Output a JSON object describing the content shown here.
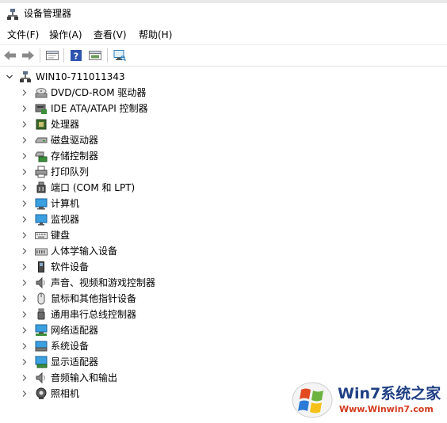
{
  "window": {
    "title": "设备管理器"
  },
  "menu": [
    {
      "label": "文件(F)"
    },
    {
      "label": "操作(A)"
    },
    {
      "label": "查看(V)"
    },
    {
      "label": "帮助(H)"
    }
  ],
  "toolbar": {
    "buttons": [
      {
        "icon": "back-arrow-icon"
      },
      {
        "icon": "forward-arrow-icon"
      },
      {
        "icon": "properties-icon"
      },
      {
        "icon": "help-icon"
      },
      {
        "icon": "update-driver-icon"
      },
      {
        "icon": "scan-hardware-icon"
      }
    ]
  },
  "tree": {
    "root": {
      "label": "WIN10-711011343",
      "icon": "computer-network-icon"
    },
    "items": [
      {
        "label": "DVD/CD-ROM 驱动器",
        "icon": "dvd-drive-icon"
      },
      {
        "label": "IDE ATA/ATAPI 控制器",
        "icon": "ide-controller-icon"
      },
      {
        "label": "处理器",
        "icon": "processor-icon"
      },
      {
        "label": "磁盘驱动器",
        "icon": "disk-drive-icon"
      },
      {
        "label": "存储控制器",
        "icon": "storage-controller-icon"
      },
      {
        "label": "打印队列",
        "icon": "printer-icon"
      },
      {
        "label": "端口 (COM 和 LPT)",
        "icon": "port-icon"
      },
      {
        "label": "计算机",
        "icon": "computer-icon"
      },
      {
        "label": "监视器",
        "icon": "monitor-icon"
      },
      {
        "label": "键盘",
        "icon": "keyboard-icon"
      },
      {
        "label": "人体学输入设备",
        "icon": "hid-icon"
      },
      {
        "label": "软件设备",
        "icon": "software-device-icon"
      },
      {
        "label": "声音、视频和游戏控制器",
        "icon": "sound-icon"
      },
      {
        "label": "鼠标和其他指针设备",
        "icon": "mouse-icon"
      },
      {
        "label": "通用串行总线控制器",
        "icon": "usb-icon"
      },
      {
        "label": "网络适配器",
        "icon": "network-adapter-icon"
      },
      {
        "label": "系统设备",
        "icon": "system-device-icon"
      },
      {
        "label": "显示适配器",
        "icon": "display-adapter-icon"
      },
      {
        "label": "音频输入和输出",
        "icon": "audio-io-icon"
      },
      {
        "label": "照相机",
        "icon": "camera-icon"
      }
    ]
  },
  "watermark": {
    "title": "Win7系统之家",
    "url": "Www.Winwin7.com"
  }
}
